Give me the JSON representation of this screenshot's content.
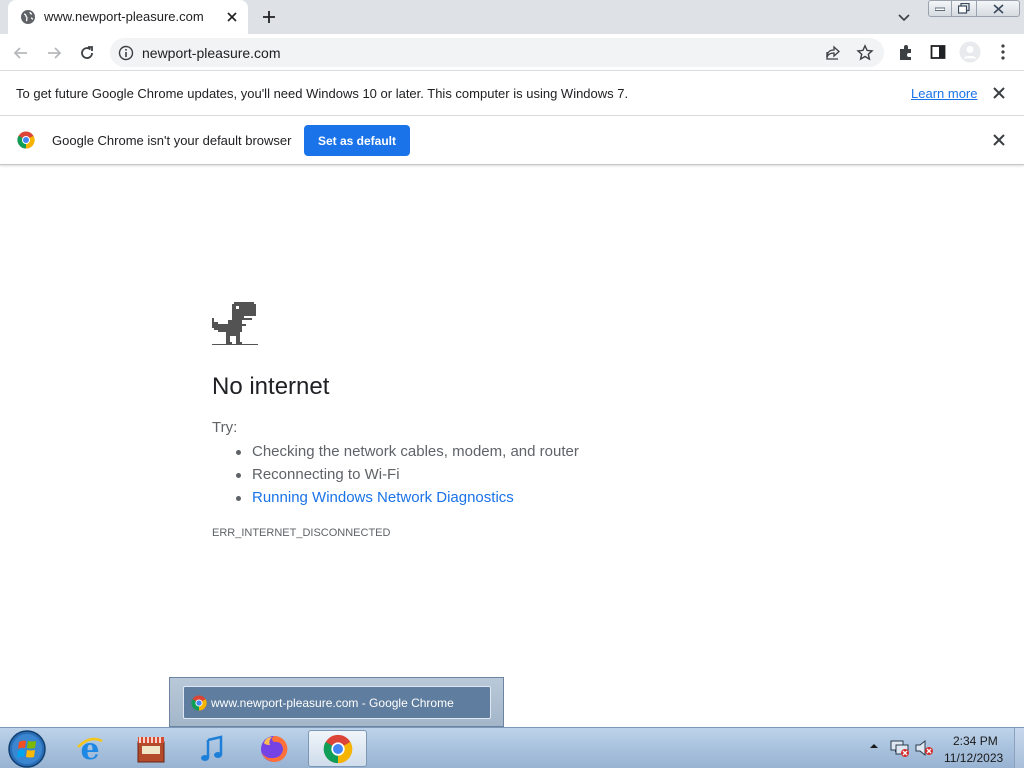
{
  "browser": {
    "tab": {
      "title": "www.newport-pleasure.com"
    },
    "omnibox": {
      "url": "newport-pleasure.com"
    }
  },
  "infobars": {
    "update": {
      "text": "To get future Google Chrome updates, you'll need Windows 10 or later. This computer is using Windows 7.",
      "link": "Learn more"
    },
    "default_browser": {
      "text": "Google Chrome isn't your default browser",
      "button": "Set as default"
    }
  },
  "error_page": {
    "title": "No internet",
    "try_label": "Try:",
    "suggestions": [
      "Checking the network cables, modem, and router",
      "Reconnecting to Wi-Fi",
      "Running Windows Network Diagnostics"
    ],
    "code": "ERR_INTERNET_DISCONNECTED"
  },
  "taskbar": {
    "preview_title": "www.newport-pleasure.com - Google Chrome",
    "pinned": [
      "start-orb-icon",
      "internet-explorer-icon",
      "app-store-icon",
      "itunes-icon",
      "firefox-icon",
      "chrome-icon"
    ],
    "clock": {
      "time": "2:34 PM",
      "date": "11/12/2023"
    }
  },
  "colors": {
    "accent": "#1a73e8",
    "tabstrip": "#dee1e6",
    "text": "#202124",
    "muted": "#5f6368"
  }
}
